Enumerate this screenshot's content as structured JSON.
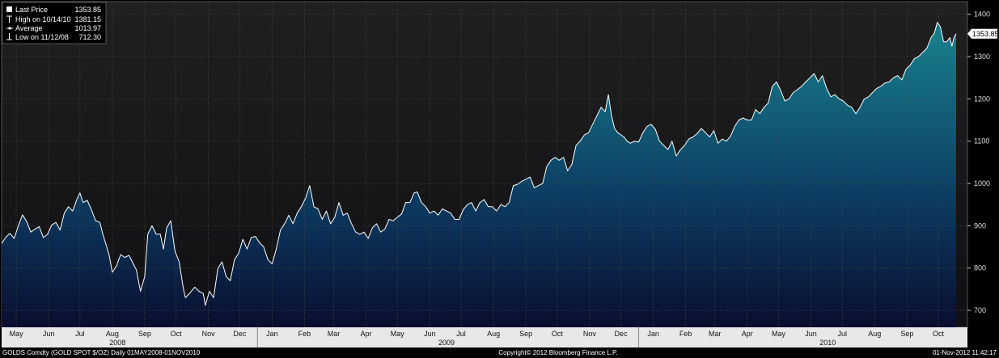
{
  "chart_data": {
    "type": "area",
    "legend": {
      "last_price_label": "Last Price",
      "last_price_value": "1353.85",
      "high_label": "High on 10/14/10",
      "high_value": "1381.15",
      "average_label": "Average",
      "average_value": "1013.97",
      "low_label": "Low on 11/12/08",
      "low_value": "712.30"
    },
    "last_price_tag": "1353.85",
    "ylim": [
      660,
      1430
    ],
    "y_ticks": [
      700,
      800,
      900,
      1000,
      1100,
      1200,
      1300,
      1400
    ],
    "x_range": [
      "2008-05-01",
      "2010-11-01"
    ],
    "month_ticks": [
      {
        "label": "May",
        "date": "2008-05-15"
      },
      {
        "label": "Jun",
        "date": "2008-06-15"
      },
      {
        "label": "Jul",
        "date": "2008-07-15"
      },
      {
        "label": "Aug",
        "date": "2008-08-15"
      },
      {
        "label": "Sep",
        "date": "2008-09-15"
      },
      {
        "label": "Oct",
        "date": "2008-10-15"
      },
      {
        "label": "Nov",
        "date": "2008-11-15"
      },
      {
        "label": "Dec",
        "date": "2008-12-15"
      },
      {
        "label": "Jan",
        "date": "2009-01-15"
      },
      {
        "label": "Feb",
        "date": "2009-02-15"
      },
      {
        "label": "Mar",
        "date": "2009-03-15"
      },
      {
        "label": "Apr",
        "date": "2009-04-15"
      },
      {
        "label": "May",
        "date": "2009-05-15"
      },
      {
        "label": "Jun",
        "date": "2009-06-15"
      },
      {
        "label": "Jul",
        "date": "2009-07-15"
      },
      {
        "label": "Aug",
        "date": "2009-08-15"
      },
      {
        "label": "Sep",
        "date": "2009-09-15"
      },
      {
        "label": "Oct",
        "date": "2009-10-15"
      },
      {
        "label": "Nov",
        "date": "2009-11-15"
      },
      {
        "label": "Dec",
        "date": "2009-12-15"
      },
      {
        "label": "Jan",
        "date": "2010-01-15"
      },
      {
        "label": "Feb",
        "date": "2010-02-15"
      },
      {
        "label": "Mar",
        "date": "2010-03-15"
      },
      {
        "label": "Apr",
        "date": "2010-04-15"
      },
      {
        "label": "May",
        "date": "2010-05-15"
      },
      {
        "label": "Jun",
        "date": "2010-06-15"
      },
      {
        "label": "Jul",
        "date": "2010-07-15"
      },
      {
        "label": "Aug",
        "date": "2010-08-15"
      },
      {
        "label": "Sep",
        "date": "2010-09-15"
      },
      {
        "label": "Oct",
        "date": "2010-10-15"
      }
    ],
    "year_ticks": [
      {
        "label": "2008",
        "date": "2008-08-20"
      },
      {
        "label": "2009",
        "date": "2009-07-01"
      },
      {
        "label": "2010",
        "date": "2010-07-01"
      }
    ],
    "year_boundaries": [
      "2009-01-01",
      "2010-01-01"
    ],
    "grid": true,
    "colors": {
      "background": "#000000",
      "plot_top": "#202020",
      "plot_bottom": "#101014",
      "area_top": "#177f8c",
      "area_mid": "#0c3d63",
      "area_bottom": "#0a0e30",
      "line": "#ffffff",
      "grid": "#4a4a4a",
      "axis_band": "#e8e8e8"
    },
    "series": [
      {
        "values": [
          [
            "2008-05-01",
            858
          ],
          [
            "2008-05-05",
            873
          ],
          [
            "2008-05-09",
            882
          ],
          [
            "2008-05-13",
            870
          ],
          [
            "2008-05-17",
            900
          ],
          [
            "2008-05-21",
            926
          ],
          [
            "2008-05-25",
            910
          ],
          [
            "2008-05-29",
            885
          ],
          [
            "2008-06-02",
            892
          ],
          [
            "2008-06-06",
            898
          ],
          [
            "2008-06-10",
            872
          ],
          [
            "2008-06-14",
            880
          ],
          [
            "2008-06-18",
            902
          ],
          [
            "2008-06-22",
            908
          ],
          [
            "2008-06-26",
            890
          ],
          [
            "2008-06-30",
            930
          ],
          [
            "2008-07-04",
            945
          ],
          [
            "2008-07-08",
            935
          ],
          [
            "2008-07-12",
            962
          ],
          [
            "2008-07-15",
            978
          ],
          [
            "2008-07-18",
            955
          ],
          [
            "2008-07-22",
            960
          ],
          [
            "2008-07-26",
            938
          ],
          [
            "2008-07-30",
            912
          ],
          [
            "2008-08-03",
            908
          ],
          [
            "2008-08-06",
            880
          ],
          [
            "2008-08-09",
            855
          ],
          [
            "2008-08-12",
            830
          ],
          [
            "2008-08-15",
            790
          ],
          [
            "2008-08-19",
            805
          ],
          [
            "2008-08-23",
            832
          ],
          [
            "2008-08-27",
            825
          ],
          [
            "2008-08-31",
            830
          ],
          [
            "2008-09-03",
            815
          ],
          [
            "2008-09-07",
            796
          ],
          [
            "2008-09-11",
            745
          ],
          [
            "2008-09-15",
            780
          ],
          [
            "2008-09-18",
            880
          ],
          [
            "2008-09-22",
            900
          ],
          [
            "2008-09-26",
            880
          ],
          [
            "2008-09-30",
            880
          ],
          [
            "2008-10-03",
            845
          ],
          [
            "2008-10-06",
            895
          ],
          [
            "2008-10-10",
            912
          ],
          [
            "2008-10-14",
            840
          ],
          [
            "2008-10-18",
            815
          ],
          [
            "2008-10-22",
            752
          ],
          [
            "2008-10-24",
            730
          ],
          [
            "2008-10-28",
            740
          ],
          [
            "2008-11-02",
            755
          ],
          [
            "2008-11-06",
            745
          ],
          [
            "2008-11-10",
            740
          ],
          [
            "2008-11-12",
            712
          ],
          [
            "2008-11-16",
            745
          ],
          [
            "2008-11-20",
            730
          ],
          [
            "2008-11-24",
            798
          ],
          [
            "2008-11-28",
            815
          ],
          [
            "2008-12-02",
            780
          ],
          [
            "2008-12-06",
            770
          ],
          [
            "2008-12-10",
            820
          ],
          [
            "2008-12-14",
            835
          ],
          [
            "2008-12-18",
            868
          ],
          [
            "2008-12-22",
            845
          ],
          [
            "2008-12-26",
            872
          ],
          [
            "2008-12-30",
            875
          ],
          [
            "2009-01-03",
            860
          ],
          [
            "2009-01-07",
            850
          ],
          [
            "2009-01-11",
            820
          ],
          [
            "2009-01-15",
            810
          ],
          [
            "2009-01-19",
            845
          ],
          [
            "2009-01-23",
            890
          ],
          [
            "2009-01-27",
            905
          ],
          [
            "2009-01-31",
            925
          ],
          [
            "2009-02-04",
            905
          ],
          [
            "2009-02-08",
            930
          ],
          [
            "2009-02-12",
            945
          ],
          [
            "2009-02-16",
            965
          ],
          [
            "2009-02-20",
            995
          ],
          [
            "2009-02-24",
            945
          ],
          [
            "2009-02-28",
            940
          ],
          [
            "2009-03-04",
            915
          ],
          [
            "2009-03-08",
            935
          ],
          [
            "2009-03-12",
            905
          ],
          [
            "2009-03-16",
            920
          ],
          [
            "2009-03-20",
            955
          ],
          [
            "2009-03-24",
            925
          ],
          [
            "2009-03-28",
            930
          ],
          [
            "2009-04-01",
            905
          ],
          [
            "2009-04-05",
            885
          ],
          [
            "2009-04-09",
            880
          ],
          [
            "2009-04-13",
            885
          ],
          [
            "2009-04-17",
            870
          ],
          [
            "2009-04-21",
            895
          ],
          [
            "2009-04-25",
            905
          ],
          [
            "2009-04-29",
            885
          ],
          [
            "2009-05-03",
            892
          ],
          [
            "2009-05-07",
            915
          ],
          [
            "2009-05-11",
            912
          ],
          [
            "2009-05-15",
            920
          ],
          [
            "2009-05-19",
            928
          ],
          [
            "2009-05-23",
            955
          ],
          [
            "2009-05-27",
            955
          ],
          [
            "2009-05-31",
            978
          ],
          [
            "2009-06-03",
            980
          ],
          [
            "2009-06-07",
            955
          ],
          [
            "2009-06-11",
            945
          ],
          [
            "2009-06-15",
            930
          ],
          [
            "2009-06-19",
            935
          ],
          [
            "2009-06-23",
            925
          ],
          [
            "2009-06-27",
            940
          ],
          [
            "2009-07-01",
            935
          ],
          [
            "2009-07-05",
            930
          ],
          [
            "2009-07-09",
            915
          ],
          [
            "2009-07-13",
            915
          ],
          [
            "2009-07-17",
            938
          ],
          [
            "2009-07-21",
            950
          ],
          [
            "2009-07-25",
            955
          ],
          [
            "2009-07-29",
            935
          ],
          [
            "2009-08-02",
            955
          ],
          [
            "2009-08-06",
            962
          ],
          [
            "2009-08-10",
            945
          ],
          [
            "2009-08-14",
            945
          ],
          [
            "2009-08-18",
            935
          ],
          [
            "2009-08-22",
            950
          ],
          [
            "2009-08-26",
            945
          ],
          [
            "2009-08-30",
            955
          ],
          [
            "2009-09-03",
            995
          ],
          [
            "2009-09-07",
            998
          ],
          [
            "2009-09-11",
            1005
          ],
          [
            "2009-09-15",
            1010
          ],
          [
            "2009-09-19",
            1015
          ],
          [
            "2009-09-23",
            990
          ],
          [
            "2009-09-27",
            995
          ],
          [
            "2009-10-01",
            1000
          ],
          [
            "2009-10-05",
            1040
          ],
          [
            "2009-10-09",
            1055
          ],
          [
            "2009-10-13",
            1062
          ],
          [
            "2009-10-17",
            1055
          ],
          [
            "2009-10-21",
            1062
          ],
          [
            "2009-10-25",
            1030
          ],
          [
            "2009-10-29",
            1045
          ],
          [
            "2009-11-02",
            1090
          ],
          [
            "2009-11-06",
            1100
          ],
          [
            "2009-11-10",
            1115
          ],
          [
            "2009-11-14",
            1120
          ],
          [
            "2009-11-18",
            1140
          ],
          [
            "2009-11-22",
            1160
          ],
          [
            "2009-11-26",
            1180
          ],
          [
            "2009-11-30",
            1170
          ],
          [
            "2009-12-03",
            1210
          ],
          [
            "2009-12-06",
            1160
          ],
          [
            "2009-12-09",
            1130
          ],
          [
            "2009-12-12",
            1120
          ],
          [
            "2009-12-15",
            1115
          ],
          [
            "2009-12-18",
            1110
          ],
          [
            "2009-12-21",
            1100
          ],
          [
            "2009-12-24",
            1095
          ],
          [
            "2009-12-28",
            1100
          ],
          [
            "2010-01-01",
            1098
          ],
          [
            "2010-01-05",
            1120
          ],
          [
            "2010-01-09",
            1135
          ],
          [
            "2010-01-13",
            1140
          ],
          [
            "2010-01-17",
            1128
          ],
          [
            "2010-01-21",
            1100
          ],
          [
            "2010-01-25",
            1090
          ],
          [
            "2010-01-29",
            1080
          ],
          [
            "2010-02-02",
            1100
          ],
          [
            "2010-02-06",
            1065
          ],
          [
            "2010-02-10",
            1080
          ],
          [
            "2010-02-14",
            1090
          ],
          [
            "2010-02-18",
            1105
          ],
          [
            "2010-02-22",
            1110
          ],
          [
            "2010-02-26",
            1118
          ],
          [
            "2010-03-02",
            1130
          ],
          [
            "2010-03-06",
            1120
          ],
          [
            "2010-03-10",
            1110
          ],
          [
            "2010-03-14",
            1125
          ],
          [
            "2010-03-18",
            1095
          ],
          [
            "2010-03-22",
            1105
          ],
          [
            "2010-03-26",
            1100
          ],
          [
            "2010-03-30",
            1112
          ],
          [
            "2010-04-03",
            1135
          ],
          [
            "2010-04-07",
            1150
          ],
          [
            "2010-04-11",
            1155
          ],
          [
            "2010-04-15",
            1150
          ],
          [
            "2010-04-19",
            1150
          ],
          [
            "2010-04-23",
            1175
          ],
          [
            "2010-04-27",
            1165
          ],
          [
            "2010-05-01",
            1180
          ],
          [
            "2010-05-05",
            1190
          ],
          [
            "2010-05-09",
            1230
          ],
          [
            "2010-05-13",
            1240
          ],
          [
            "2010-05-17",
            1220
          ],
          [
            "2010-05-21",
            1195
          ],
          [
            "2010-05-25",
            1200
          ],
          [
            "2010-05-29",
            1215
          ],
          [
            "2010-06-02",
            1222
          ],
          [
            "2010-06-06",
            1230
          ],
          [
            "2010-06-10",
            1240
          ],
          [
            "2010-06-14",
            1250
          ],
          [
            "2010-06-18",
            1260
          ],
          [
            "2010-06-22",
            1240
          ],
          [
            "2010-06-26",
            1255
          ],
          [
            "2010-06-30",
            1225
          ],
          [
            "2010-07-04",
            1205
          ],
          [
            "2010-07-08",
            1210
          ],
          [
            "2010-07-12",
            1200
          ],
          [
            "2010-07-16",
            1195
          ],
          [
            "2010-07-20",
            1185
          ],
          [
            "2010-07-24",
            1180
          ],
          [
            "2010-07-28",
            1165
          ],
          [
            "2010-08-01",
            1180
          ],
          [
            "2010-08-05",
            1200
          ],
          [
            "2010-08-09",
            1205
          ],
          [
            "2010-08-13",
            1215
          ],
          [
            "2010-08-17",
            1225
          ],
          [
            "2010-08-21",
            1230
          ],
          [
            "2010-08-25",
            1238
          ],
          [
            "2010-08-29",
            1240
          ],
          [
            "2010-09-02",
            1250
          ],
          [
            "2010-09-06",
            1255
          ],
          [
            "2010-09-10",
            1245
          ],
          [
            "2010-09-14",
            1270
          ],
          [
            "2010-09-18",
            1280
          ],
          [
            "2010-09-22",
            1295
          ],
          [
            "2010-09-26",
            1300
          ],
          [
            "2010-09-30",
            1310
          ],
          [
            "2010-10-04",
            1320
          ],
          [
            "2010-10-08",
            1345
          ],
          [
            "2010-10-11",
            1355
          ],
          [
            "2010-10-14",
            1381
          ],
          [
            "2010-10-17",
            1370
          ],
          [
            "2010-10-20",
            1335
          ],
          [
            "2010-10-23",
            1335
          ],
          [
            "2010-10-26",
            1345
          ],
          [
            "2010-10-28",
            1325
          ],
          [
            "2010-10-30",
            1345
          ],
          [
            "2010-11-01",
            1354
          ]
        ]
      }
    ]
  },
  "footer": {
    "left": "GOLDS Comdty (GOLD SPOT $/OZ) Daily 01MAY2008-01NOV2010",
    "center": "Copyright© 2012 Bloomberg Finance L.P.",
    "right": "01-Nov-2012 11:42:17"
  }
}
